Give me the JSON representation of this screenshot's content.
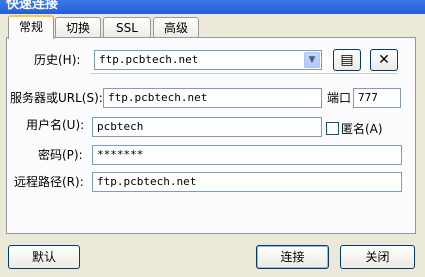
{
  "window": {
    "title": "快速连接"
  },
  "tabs": [
    {
      "label": "常规",
      "active": true
    },
    {
      "label": "切换",
      "active": false
    },
    {
      "label": "SSL",
      "active": false
    },
    {
      "label": "高级",
      "active": false
    }
  ],
  "form": {
    "history_label": "历史(H):",
    "history_value": "ftp.pcbtech.net",
    "server_label": "服务器或URL(S):",
    "server_value": "ftp.pcbtech.net",
    "port_label": "端口",
    "port_value": "777",
    "user_label": "用户名(U):",
    "user_value": "pcbtech",
    "anonymous_label": "匿名(A)",
    "anonymous_checked": false,
    "password_label": "密码(P):",
    "password_value": "*******",
    "remote_path_label": "远程路径(R):",
    "remote_path_value": "ftp.pcbtech.net"
  },
  "icons": {
    "history_dropdown": "chevron-down-icon",
    "history_edit": "list-icon",
    "history_delete": "close-icon"
  },
  "buttons": {
    "default_label": "默认",
    "connect_label": "连接",
    "close_label": "关闭"
  }
}
